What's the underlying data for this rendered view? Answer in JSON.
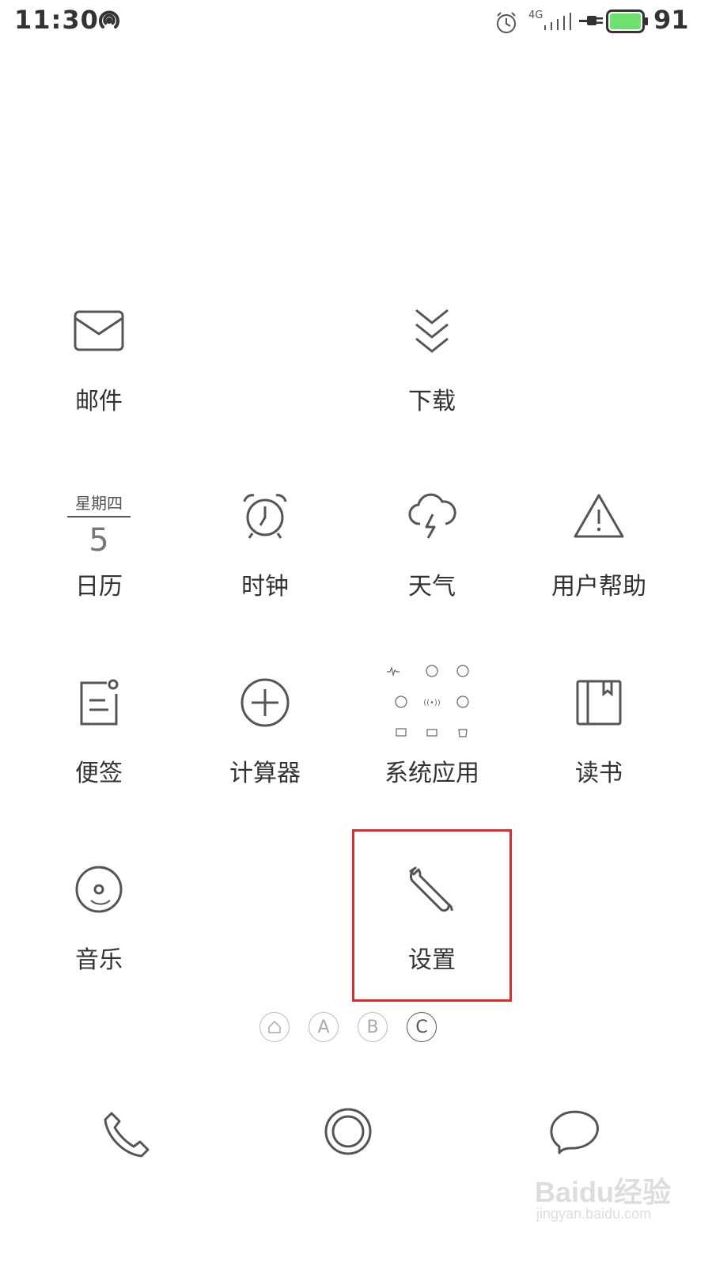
{
  "status_bar": {
    "time": "11:30",
    "network_type": "4G",
    "battery_level": "91",
    "icons": [
      "wifi-hotspot-icon",
      "alarm-icon",
      "signal-icon",
      "charging-icon",
      "battery-icon"
    ]
  },
  "apps": [
    {
      "id": "mail",
      "label": "邮件",
      "icon": "mail-icon"
    },
    {
      "id": "download",
      "label": "下载",
      "icon": "download-icon"
    },
    {
      "id": "calendar",
      "label": "日历",
      "icon": "calendar-icon",
      "weekday": "星期四",
      "day": "5"
    },
    {
      "id": "clock",
      "label": "时钟",
      "icon": "alarm-clock-icon"
    },
    {
      "id": "weather",
      "label": "天气",
      "icon": "cloud-lightning-icon"
    },
    {
      "id": "help",
      "label": "用户帮助",
      "icon": "warning-icon"
    },
    {
      "id": "notes",
      "label": "便签",
      "icon": "note-icon"
    },
    {
      "id": "calculator",
      "label": "计算器",
      "icon": "plus-circle-icon"
    },
    {
      "id": "system-apps",
      "label": "系统应用",
      "icon": "folder-grid-icon"
    },
    {
      "id": "reader",
      "label": "读书",
      "icon": "book-icon"
    },
    {
      "id": "music",
      "label": "音乐",
      "icon": "disc-icon"
    },
    {
      "id": "settings",
      "label": "设置",
      "icon": "wrench-icon"
    }
  ],
  "page_indicators": [
    {
      "label": "",
      "icon": "home-icon",
      "active": false
    },
    {
      "label": "A",
      "active": false
    },
    {
      "label": "B",
      "active": false
    },
    {
      "label": "C",
      "active": true
    }
  ],
  "dock": [
    {
      "id": "phone",
      "icon": "phone-icon"
    },
    {
      "id": "browser",
      "icon": "browser-ring-icon"
    },
    {
      "id": "messages",
      "icon": "chat-bubble-icon"
    }
  ],
  "watermark": {
    "text": "Baidu经验",
    "url": "jingyan.baidu.com"
  },
  "colors": {
    "highlight": "#d32f2f",
    "icon_stroke": "#555555",
    "text": "#333333",
    "battery_fill": "#6ee06e"
  }
}
